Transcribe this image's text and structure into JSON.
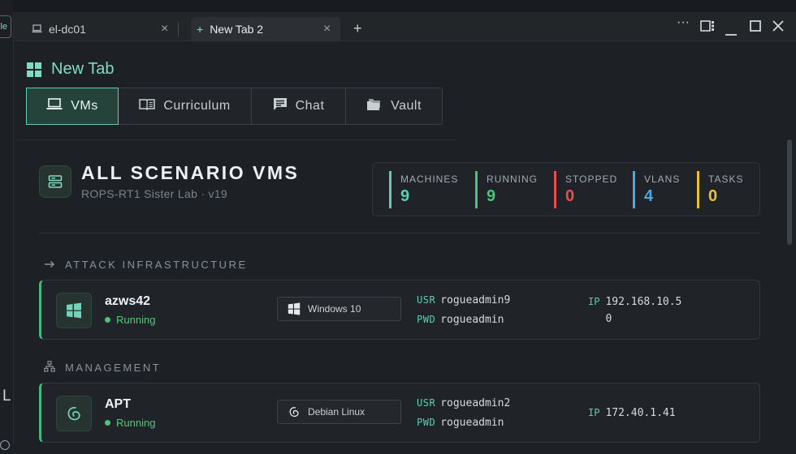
{
  "background": {
    "side_tag": "ile",
    "side_letter": "L"
  },
  "tabs": [
    {
      "label": "el-dc01",
      "icon": "laptop-icon",
      "close": "×"
    },
    {
      "label": "New Tab 2",
      "icon": "plus-icon",
      "close": "×",
      "active": true
    }
  ],
  "tabbar": {
    "add": "+",
    "more": "···"
  },
  "page": {
    "title": "New Tab"
  },
  "nav": [
    {
      "label": "VMs",
      "icon": "laptop-icon",
      "active": true
    },
    {
      "label": "Curriculum",
      "icon": "book-icon"
    },
    {
      "label": "Chat",
      "icon": "chat-icon"
    },
    {
      "label": "Vault",
      "icon": "folder-icon"
    }
  ],
  "header": {
    "title": "ALL SCENARIO VMS",
    "subtitle": "ROPS-RT1 Sister Lab · v19"
  },
  "stats": [
    {
      "label": "MACHINES",
      "value": "9",
      "color": "#5fcdb1"
    },
    {
      "label": "RUNNING",
      "value": "9",
      "color": "#4ec27a"
    },
    {
      "label": "STOPPED",
      "value": "0",
      "color": "#e05252"
    },
    {
      "label": "VLANS",
      "value": "4",
      "color": "#4aa8e8"
    },
    {
      "label": "TASKS",
      "value": "0",
      "color": "#e8c23a"
    }
  ],
  "sections": [
    {
      "title": "ATTACK INFRASTRUCTURE",
      "icon": "arrow-right-icon",
      "vms": [
        {
          "name": "azws42",
          "status": "Running",
          "os": "Windows 10",
          "os_icon": "windows-icon",
          "usr_label": "USR",
          "usr": "rogueadmin9",
          "pwd_label": "PWD",
          "pwd": "rogueadmin",
          "ip_label": "IP",
          "ip": "192.168.10.50"
        }
      ]
    },
    {
      "title": "MANAGEMENT",
      "icon": "network-icon",
      "vms": [
        {
          "name": "APT",
          "status": "Running",
          "os": "Debian Linux",
          "os_icon": "debian-icon",
          "usr_label": "USR",
          "usr": "rogueadmin2",
          "pwd_label": "PWD",
          "pwd": "rogueadmin",
          "ip_label": "IP",
          "ip": "172.40.1.41"
        }
      ]
    }
  ]
}
